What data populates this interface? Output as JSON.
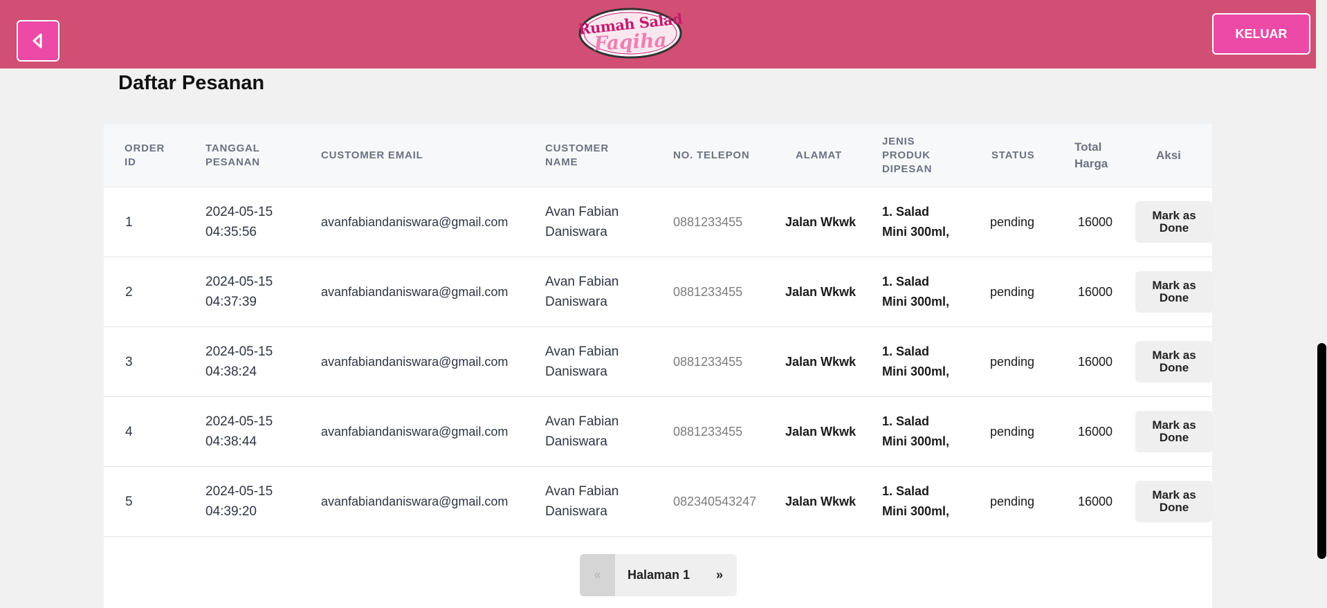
{
  "header": {
    "logo_line1": "Rumah Salad",
    "logo_line2": "Faqiha",
    "logout_label": "KELUAR"
  },
  "page": {
    "title": "Daftar Pesanan"
  },
  "table": {
    "columns": [
      {
        "line1": "ORDER",
        "line2": "ID"
      },
      {
        "line1": "TANGGAL",
        "line2": "PESANAN"
      },
      {
        "line1": "CUSTOMER EMAIL",
        "line2": ""
      },
      {
        "line1": "CUSTOMER",
        "line2": "NAME"
      },
      {
        "line1": "NO. TELEPON",
        "line2": ""
      },
      {
        "line1": "ALAMAT",
        "line2": ""
      },
      {
        "line1": "JENIS",
        "line2": "PRODUK",
        "line3": "DIPESAN"
      },
      {
        "line1": "STATUS",
        "line2": ""
      },
      {
        "line1": "Total",
        "line2": "Harga"
      },
      {
        "line1": "Aksi",
        "line2": ""
      }
    ],
    "rows": [
      {
        "id": "1",
        "date": "2024-05-15",
        "time": "04:35:56",
        "email": "avanfabiandaniswara@gmail.com",
        "name1": "Avan Fabian",
        "name2": "Daniswara",
        "phone": "0881233455",
        "address": "Jalan Wkwk",
        "product1": "1. Salad",
        "product2": "Mini 300ml,",
        "status": "pending",
        "total": "16000",
        "action1": "Mark as",
        "action2": "Done"
      },
      {
        "id": "2",
        "date": "2024-05-15",
        "time": "04:37:39",
        "email": "avanfabiandaniswara@gmail.com",
        "name1": "Avan Fabian",
        "name2": "Daniswara",
        "phone": "0881233455",
        "address": "Jalan Wkwk",
        "product1": "1. Salad",
        "product2": "Mini 300ml,",
        "status": "pending",
        "total": "16000",
        "action1": "Mark as",
        "action2": "Done"
      },
      {
        "id": "3",
        "date": "2024-05-15",
        "time": "04:38:24",
        "email": "avanfabiandaniswara@gmail.com",
        "name1": "Avan Fabian",
        "name2": "Daniswara",
        "phone": "0881233455",
        "address": "Jalan Wkwk",
        "product1": "1. Salad",
        "product2": "Mini 300ml,",
        "status": "pending",
        "total": "16000",
        "action1": "Mark as",
        "action2": "Done"
      },
      {
        "id": "4",
        "date": "2024-05-15",
        "time": "04:38:44",
        "email": "avanfabiandaniswara@gmail.com",
        "name1": "Avan Fabian",
        "name2": "Daniswara",
        "phone": "0881233455",
        "address": "Jalan Wkwk",
        "product1": "1. Salad",
        "product2": "Mini 300ml,",
        "status": "pending",
        "total": "16000",
        "action1": "Mark as",
        "action2": "Done"
      },
      {
        "id": "5",
        "date": "2024-05-15",
        "time": "04:39:20",
        "email": "avanfabiandaniswara@gmail.com",
        "name1": "Avan Fabian",
        "name2": "Daniswara",
        "phone": "082340543247",
        "address": "Jalan Wkwk",
        "product1": "1. Salad",
        "product2": "Mini 300ml,",
        "status": "pending",
        "total": "16000",
        "action1": "Mark as",
        "action2": "Done"
      }
    ]
  },
  "pagination": {
    "prev": "«",
    "label": "Halaman 1",
    "next": "»"
  },
  "icons": {
    "back": "back-arrow-icon"
  },
  "colors": {
    "header_bg": "#d14f74",
    "button_pink": "#ec4aa6"
  }
}
